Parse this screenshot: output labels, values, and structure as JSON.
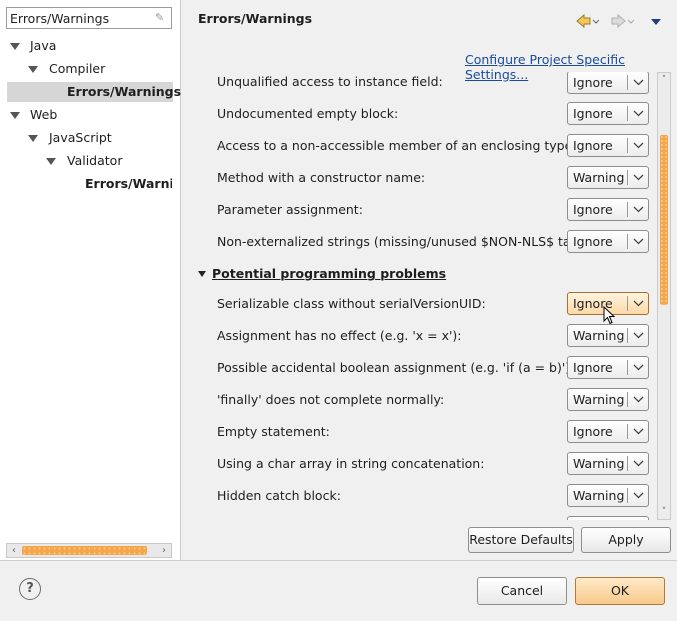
{
  "filter": {
    "value": "Errors/Warnings"
  },
  "tree": {
    "java": "Java",
    "compiler": "Compiler",
    "errors_warnings_java": "Errors/Warnings",
    "web": "Web",
    "javascript": "JavaScript",
    "validator": "Validator",
    "errors_warnings_web": "Errors/Warnings"
  },
  "header": {
    "title": "Errors/Warnings",
    "configure_link": "Configure Project Specific Settings..."
  },
  "rows": [
    {
      "label": "Unqualified access to instance field:",
      "value": "Ignore"
    },
    {
      "label": "Undocumented empty block:",
      "value": "Ignore"
    },
    {
      "label": "Access to a non-accessible member of an enclosing type:",
      "value": "Ignore"
    },
    {
      "label": "Method with a constructor name:",
      "value": "Warning"
    },
    {
      "label": "Parameter assignment:",
      "value": "Ignore"
    },
    {
      "label": "Non-externalized strings (missing/unused $NON-NLS$ tag):",
      "value": "Ignore"
    }
  ],
  "section": {
    "label": "Potential programming problems"
  },
  "rows2": [
    {
      "label": "Serializable class without serialVersionUID:",
      "value": "Ignore"
    },
    {
      "label": "Assignment has no effect (e.g. 'x = x'):",
      "value": "Warning"
    },
    {
      "label": "Possible accidental boolean assignment (e.g. 'if (a = b)'):",
      "value": "Ignore"
    },
    {
      "label": "'finally' does not complete normally:",
      "value": "Warning"
    },
    {
      "label": "Empty statement:",
      "value": "Ignore"
    },
    {
      "label": "Using a char array in string concatenation:",
      "value": "Warning"
    },
    {
      "label": "Hidden catch block:",
      "value": "Warning"
    }
  ],
  "buttons": {
    "restore_defaults": "Restore Defaults",
    "apply": "Apply",
    "cancel": "Cancel",
    "ok": "OK"
  },
  "icons": {
    "help": "help-icon",
    "back": "back-arrow-icon",
    "forward": "forward-arrow-icon",
    "menu": "view-menu-icon"
  },
  "colors": {
    "accent": "#f5a54a",
    "link": "#1a4b9c",
    "selection": "#d6d6d6"
  }
}
